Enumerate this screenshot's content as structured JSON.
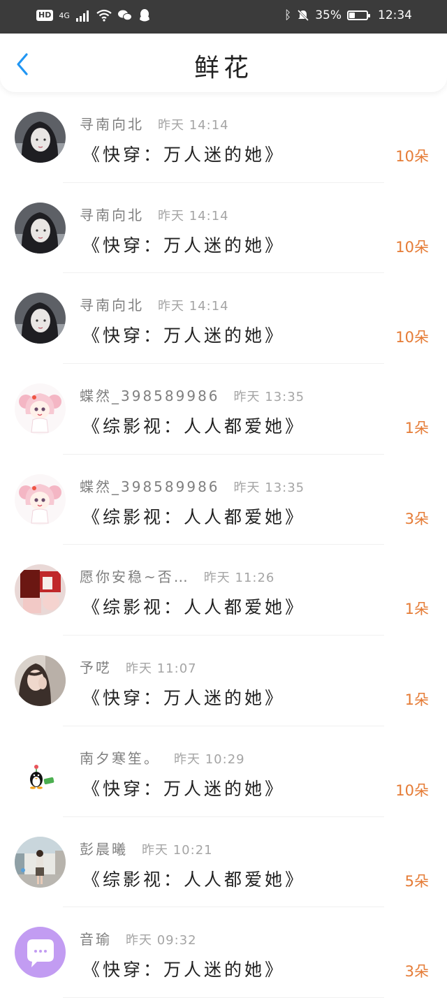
{
  "status_bar": {
    "hd": "HD",
    "network": "4G",
    "battery_percent": "35%",
    "battery_level": 0.35,
    "time": "12:34",
    "icons": [
      "signal-icon",
      "wifi-icon",
      "wechat-icon",
      "qq-icon",
      "bluetooth-icon",
      "mute-icon",
      "battery-icon"
    ]
  },
  "header": {
    "title": "鲜花",
    "back_icon": "chevron-left-icon"
  },
  "colors": {
    "accent": "#2196f3",
    "count": "#e57b35",
    "status_bar_bg": "#3b3b3b"
  },
  "items": [
    {
      "name": "寻南向北",
      "time": "昨天 14:14",
      "book": "《快穿：万人迷的她》",
      "count": "10朵",
      "avatar": "dark-hair-girl"
    },
    {
      "name": "寻南向北",
      "time": "昨天 14:14",
      "book": "《快穿：万人迷的她》",
      "count": "10朵",
      "avatar": "dark-hair-girl"
    },
    {
      "name": "寻南向北",
      "time": "昨天 14:14",
      "book": "《快穿：万人迷的她》",
      "count": "10朵",
      "avatar": "dark-hair-girl"
    },
    {
      "name": "蝶然_398589986",
      "time": "昨天 13:35",
      "book": "《综影视：人人都爱她》",
      "count": "1朵",
      "avatar": "pink-anime-girl"
    },
    {
      "name": "蝶然_398589986",
      "time": "昨天 13:35",
      "book": "《综影视：人人都爱她》",
      "count": "3朵",
      "avatar": "pink-anime-girl"
    },
    {
      "name": "愿你安稳~否…",
      "time": "昨天 11:26",
      "book": "《综影视：人人都爱她》",
      "count": "1朵",
      "avatar": "red-photo"
    },
    {
      "name": "予呓",
      "time": "昨天 11:07",
      "book": "《快穿：万人迷的她》",
      "count": "1朵",
      "avatar": "photo-girl"
    },
    {
      "name": "南夕寒笙。",
      "time": "昨天 10:29",
      "book": "《快穿：万人迷的她》",
      "count": "10朵",
      "avatar": "penguin"
    },
    {
      "name": "彭晨曦",
      "time": "昨天 10:21",
      "book": "《综影视：人人都爱她》",
      "count": "5朵",
      "avatar": "street-photo"
    },
    {
      "name": "音瑜",
      "time": "昨天 09:32",
      "book": "《快穿：万人迷的她》",
      "count": "3朵",
      "avatar": "purple-chat"
    }
  ]
}
